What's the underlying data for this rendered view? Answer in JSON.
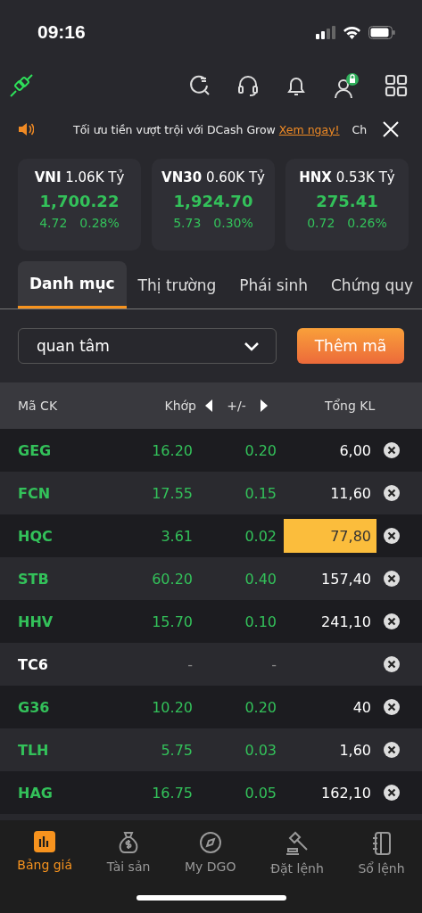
{
  "status_bar": {
    "time": "09:16"
  },
  "ticker": {
    "text": "Tối ưu tiền vượt trội với DCash Grow ",
    "link": "Xem ngay!",
    "next": "Ch"
  },
  "index_cards": [
    {
      "name": "VNI",
      "value_traded": "1.06K Tỷ",
      "index": "1,700.22",
      "change": "4.72",
      "percent": "0.28%"
    },
    {
      "name": "VN30",
      "value_traded": "0.60K Tỷ",
      "index": "1,924.70",
      "change": "5.73",
      "percent": "0.30%"
    },
    {
      "name": "HNX",
      "value_traded": "0.53K Tỷ",
      "index": "275.41",
      "change": "0.72",
      "percent": "0.26%"
    }
  ],
  "tabs": [
    {
      "label": "Danh mục",
      "selected": true
    },
    {
      "label": "Thị trường",
      "selected": false
    },
    {
      "label": "Phái sinh",
      "selected": false
    },
    {
      "label": "Chứng quy",
      "selected": false
    }
  ],
  "watchlist_select": {
    "value": "quan tâm"
  },
  "add_button": "Thêm mã",
  "table": {
    "columns": [
      "Mã CK",
      "Khớp",
      "+/-",
      "Tổng KL"
    ],
    "rows": [
      {
        "symbol": "GEG",
        "price": "16.20",
        "change": "0.20",
        "volume": "6,00",
        "highlighted": false
      },
      {
        "symbol": "FCN",
        "price": "17.55",
        "change": "0.15",
        "volume": "11,60",
        "highlighted": false
      },
      {
        "symbol": "HQC",
        "price": "3.61",
        "change": "0.02",
        "volume": "77,80",
        "highlighted": true
      },
      {
        "symbol": "STB",
        "price": "60.20",
        "change": "0.40",
        "volume": "157,40",
        "highlighted": false
      },
      {
        "symbol": "HHV",
        "price": "15.70",
        "change": "0.10",
        "volume": "241,10",
        "highlighted": false
      },
      {
        "symbol": "TC6",
        "price": "-",
        "change": "-",
        "volume": "",
        "highlighted": false,
        "kind": "reference"
      },
      {
        "symbol": "G36",
        "price": "10.20",
        "change": "0.20",
        "volume": "40",
        "highlighted": false
      },
      {
        "symbol": "TLH",
        "price": "5.75",
        "change": "0.03",
        "volume": "1,60",
        "highlighted": false
      },
      {
        "symbol": "HAG",
        "price": "16.75",
        "change": "0.05",
        "volume": "162,10",
        "highlighted": false
      }
    ]
  },
  "bottom_nav": [
    {
      "label": "Bảng giá",
      "selected": true,
      "kind": "chart"
    },
    {
      "label": "Tài sản",
      "selected": false,
      "kind": "moneybag"
    },
    {
      "label": "My DGO",
      "selected": false,
      "kind": "compass"
    },
    {
      "label": "Đặt lệnh",
      "selected": false,
      "kind": "gavel"
    },
    {
      "label": "Sổ lệnh",
      "selected": false,
      "kind": "notebook"
    }
  ]
}
